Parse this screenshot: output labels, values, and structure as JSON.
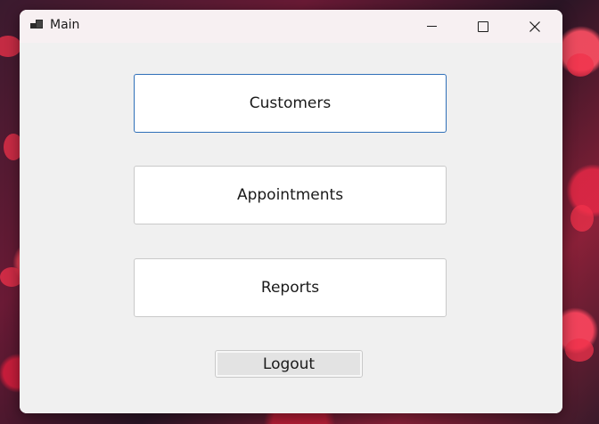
{
  "window": {
    "title": "Main"
  },
  "caption_buttons": {
    "minimize_icon": "minimize-icon",
    "maximize_icon": "maximize-icon",
    "close_icon": "close-icon"
  },
  "main": {
    "customers_label": "Customers",
    "appointments_label": "Appointments",
    "reports_label": "Reports",
    "logout_label": "Logout"
  },
  "colors": {
    "focus_border": "#2f6fb8",
    "window_bg": "#f0f0f0",
    "titlebar_bg": "#f7f0f2"
  }
}
